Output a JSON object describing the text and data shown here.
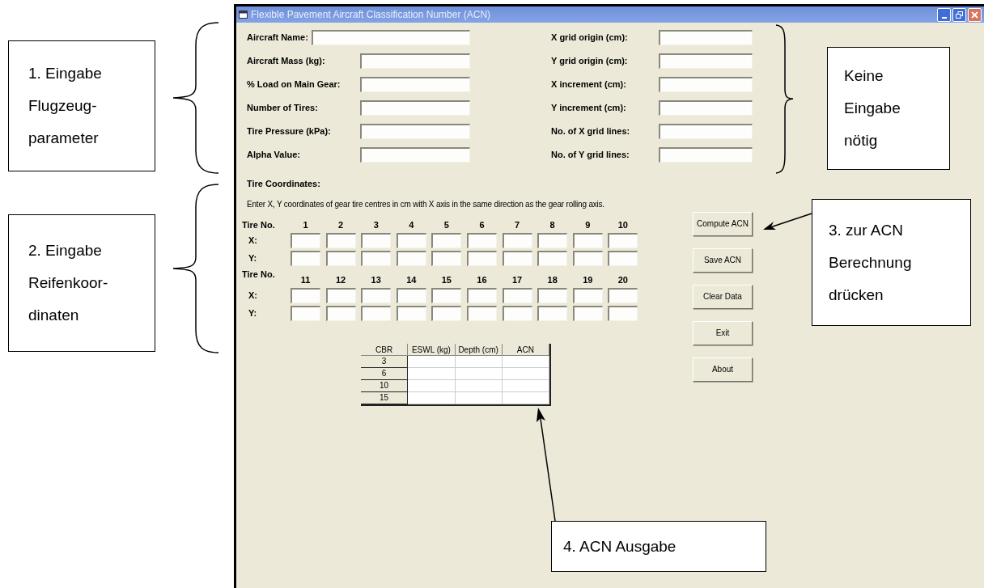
{
  "window": {
    "title": "Flexible Pavement Aircraft Classification Number (ACN)"
  },
  "aircraft_fields": [
    {
      "label": "Aircraft Name:",
      "kind": "wide"
    },
    {
      "label": "Aircraft Mass (kg):",
      "kind": "normal"
    },
    {
      "label": "% Load on Main Gear:",
      "kind": "normal"
    },
    {
      "label": "Number of Tires:",
      "kind": "normal"
    },
    {
      "label": "Tire Pressure (kPa):",
      "kind": "normal"
    },
    {
      "label": "Alpha Value:",
      "kind": "normal"
    }
  ],
  "grid_fields": [
    {
      "label": "X grid origin (cm):"
    },
    {
      "label": "Y grid origin (cm):"
    },
    {
      "label": "X increment (cm):"
    },
    {
      "label": "Y increment (cm):"
    },
    {
      "label": "No. of X grid lines:"
    },
    {
      "label": "No. of Y grid lines:"
    }
  ],
  "tire_coordinates": {
    "title": "Tire Coordinates:",
    "instruction": "Enter X, Y coordinates of gear tire centres in cm with X axis in the same direction as the gear rolling axis.",
    "groups": [
      {
        "heading": "Tire No.",
        "numbers": [
          "1",
          "2",
          "3",
          "4",
          "5",
          "6",
          "7",
          "8",
          "9",
          "10"
        ],
        "x_label": "X:",
        "y_label": "Y:"
      },
      {
        "heading": "Tire No.",
        "numbers": [
          "11",
          "12",
          "13",
          "14",
          "15",
          "16",
          "17",
          "18",
          "19",
          "20"
        ],
        "x_label": "X:",
        "y_label": "Y:"
      }
    ]
  },
  "buttons": [
    "Compute ACN",
    "Save ACN",
    "Clear Data",
    "Exit",
    "About"
  ],
  "results_table": {
    "columns": [
      "CBR",
      "ESWL (kg)",
      "Depth (cm)",
      "ACN"
    ],
    "rows": [
      "3",
      "6",
      "10",
      "15"
    ]
  },
  "annotations": [
    {
      "lines": [
        "1. Eingabe",
        "Flugzeug-",
        "parameter"
      ]
    },
    {
      "lines": [
        "2. Eingabe",
        "Reifenkoor-",
        "dinaten"
      ]
    },
    {
      "lines": [
        "Keine",
        "Eingabe",
        "nötig"
      ]
    },
    {
      "lines": [
        "3. zur ACN",
        "Berechnung",
        "drücken"
      ]
    },
    {
      "lines": [
        "4. ACN Ausgabe"
      ]
    }
  ]
}
